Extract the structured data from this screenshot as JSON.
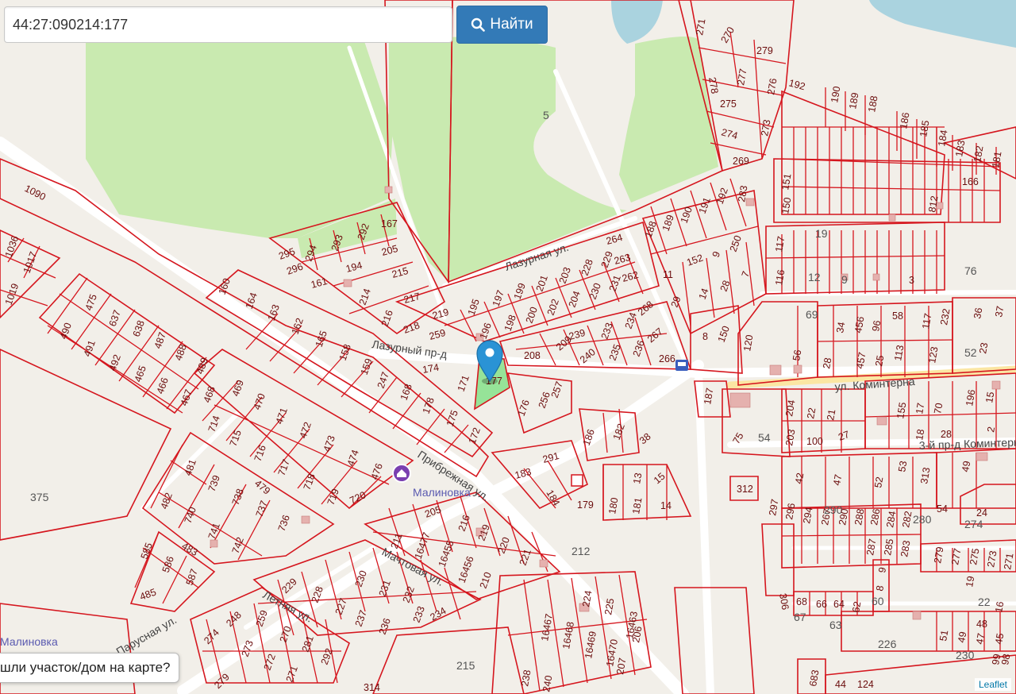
{
  "search": {
    "value": "44:27:090214:177",
    "button_label": "Найти"
  },
  "prompt": "шли участок/дом на карте?",
  "attribution": "Leaflet",
  "map": {
    "colors": {
      "land": "#f2efe9",
      "green": "#c9eab0",
      "water": "#aad3df",
      "road": "#ffffff",
      "main_road": "#fbe6a3",
      "plot_border": "#d5161e",
      "highlight": "#86e08a",
      "marker": "#2a93d5",
      "place_icon": "#7a3fb0"
    },
    "selected_plot": "177",
    "streets": {
      "lazurnaya": "Лазурная ул.",
      "lazurny": "Лазурный пр-д",
      "komintern": "ул. Коминтерна",
      "komintern3": "3-й пр-д Коминтерна",
      "pribrezhnaya": "Прибрежная ул.",
      "machtovaya": "Мачтовая ул.",
      "letnyaya": "Летняя ул.",
      "parusnaya": "Парусная ул."
    },
    "places": {
      "malinovka_poi": "Малиновка",
      "malinovka_area": "Малиновка"
    },
    "areas": {
      "a5": "5",
      "a375": "375",
      "a215": "215",
      "a212": "212",
      "a54": "54",
      "a69": "69",
      "a76": "76",
      "a52": "52",
      "a19": "19",
      "a9": "9",
      "a12": "12",
      "a22": "22",
      "a60": "60",
      "a67": "67",
      "a63": "63",
      "a226": "226",
      "a230": "230",
      "a280": "280",
      "a274": "274",
      "a290": "290"
    },
    "plots": {
      "p177": "177",
      "p1090": "1090",
      "p1036": "1036",
      "p1017": "1017",
      "p1019": "1019",
      "p490": "490",
      "p475": "475",
      "p491": "491",
      "p637": "637",
      "p638": "638",
      "p492": "492",
      "p487": "487",
      "p488": "488",
      "p465": "465",
      "p466": "466",
      "p489": "489",
      "p467": "467",
      "p468": "468",
      "p295": "295",
      "p294": "294",
      "p293": "293",
      "p292": "292",
      "p167": "167",
      "p296": "296",
      "p161": "161",
      "p194": "194",
      "p205": "205",
      "p215": "215",
      "p214": "214",
      "p217": "217",
      "p216": "216",
      "p218": "218",
      "p219": "219",
      "p259": "259",
      "p195": "195",
      "p197": "197",
      "p199": "199",
      "p201": "201",
      "p203": "203",
      "p228": "228",
      "p229": "229",
      "p264": "264",
      "p196": "196",
      "p198": "198",
      "p200": "200",
      "p202": "202",
      "p204": "204",
      "p230": "230",
      "p231": "231",
      "p263": "263",
      "p262": "262",
      "p160": "160",
      "p164": "164",
      "p163": "163",
      "p162": "162",
      "p165": "165",
      "p158": "158",
      "p159": "159",
      "p174": "174",
      "p247": "247",
      "p168": "168",
      "p171": "171",
      "p178": "178",
      "p175": "175",
      "p172": "172",
      "p208": "208",
      "p209": "209",
      "p239": "239",
      "p240": "240",
      "p233": "233",
      "p235": "235",
      "p234": "234",
      "p236": "236",
      "p268": "268",
      "p267": "267",
      "p266": "266",
      "p176": "176",
      "p256": "256",
      "p257": "257",
      "p186": "186",
      "p182": "182",
      "p38": "38",
      "p291": "291",
      "p183": "183",
      "p184": "184",
      "p179": "179",
      "p180": "180",
      "p181": "181",
      "p13": "13",
      "p15": "15",
      "p14": "14",
      "p714": "714",
      "p469": "469",
      "p470": "470",
      "p715": "715",
      "p471": "471",
      "p716": "716",
      "p472": "472",
      "p717": "717",
      "p473": "473",
      "p718": "718",
      "p474": "474",
      "p719": "719",
      "p476": "476",
      "p720": "720",
      "p481": "481",
      "p739": "739",
      "p479": "479",
      "p482": "482",
      "p740": "740",
      "p738": "738",
      "p737": "737",
      "p741": "741",
      "p736": "736",
      "p742": "742",
      "p483": "483",
      "p585": "585",
      "p586": "586",
      "p587": "587",
      "p485": "485",
      "p211": "211",
      "p205b": "205",
      "p16477": "16477",
      "p16455": "16455",
      "p216b": "216",
      "p219b": "219",
      "p220": "220",
      "p221": "221",
      "p16456": "16456",
      "p210": "210",
      "p229b": "229",
      "p228b": "228",
      "p227": "227",
      "p230b": "230",
      "p231b": "231",
      "p232": "232",
      "p233b": "233",
      "p234b": "234",
      "p237": "237",
      "p236b": "236",
      "p248": "248",
      "p274": "274",
      "p259b": "259",
      "p273": "273",
      "p270": "270",
      "p272": "272",
      "p281": "281",
      "p271": "271",
      "p292b": "292",
      "p279": "279",
      "p16467": "16467",
      "p16468": "16468",
      "p224": "224",
      "p225": "225",
      "p16463": "16463",
      "p16469": "16469",
      "p16470": "16470",
      "p206": "206",
      "p207": "207",
      "p238": "238",
      "p240b": "240",
      "p314": "314",
      "p271c": "271",
      "p270c": "270",
      "p279c": "279",
      "p278": "278",
      "p277": "277",
      "p276": "276",
      "p275": "275",
      "p274c": "274",
      "p273c": "273",
      "p269": "269",
      "p283": "283",
      "p192": "192",
      "p191": "191",
      "p190": "190",
      "p189": "189",
      "p188": "188",
      "p192n": "192",
      "p190n": "190",
      "p189n": "189",
      "p188n": "188",
      "p186n": "186",
      "p185": "185",
      "p184n": "184",
      "p183n": "183",
      "p182n": "182",
      "p181n": "181",
      "p166": "166",
      "p151": "151",
      "p150": "150",
      "p812": "812",
      "p117": "117",
      "p116": "116",
      "p3": "3",
      "p11": "11",
      "p152": "152",
      "p9": "9",
      "p250": "250",
      "p29": "29",
      "p14b": "14",
      "p28": "28",
      "p7": "7",
      "p8": "8",
      "p150b": "150",
      "p120": "120",
      "p56": "56",
      "p28b": "28",
      "p34": "34",
      "p456": "456",
      "p96": "96",
      "p58": "58",
      "p117b": "117",
      "p232b": "232",
      "p36": "36",
      "p37": "37",
      "p457": "457",
      "p25": "25",
      "p113": "113",
      "p123": "123",
      "p23": "23",
      "p187": "187",
      "p75": "75",
      "p204b": "204",
      "p22": "22",
      "p21": "21",
      "p155": "155",
      "p17": "17",
      "p70": "70",
      "p196b": "196",
      "p15b": "15",
      "p203b": "203",
      "p100": "100",
      "p27": "27",
      "p18": "18",
      "p28c": "28",
      "p2": "2",
      "p312": "312",
      "p42": "42",
      "p47": "47",
      "p52": "52",
      "p53": "53",
      "p313": "313",
      "p49": "49",
      "p54": "54",
      "p24": "24",
      "p297": "297",
      "p296b": "296",
      "p294b": "294",
      "p267b": "267",
      "p290b": "290",
      "p288": "288",
      "p286": "286",
      "p284": "284",
      "p282": "282",
      "p287": "287",
      "p285": "285",
      "p283b": "283",
      "p279b": "279",
      "p277b": "277",
      "p275b": "275",
      "p273b": "273",
      "p271b": "271",
      "p19": "19",
      "p306": "306",
      "p9b": "9",
      "p8b": "8",
      "p68": "68",
      "p66": "66",
      "p64": "64",
      "p62": "62",
      "p48": "48",
      "p51": "51",
      "p49b": "49",
      "p47b": "47",
      "p45": "45",
      "p683": "683",
      "p44": "44",
      "p124": "124",
      "p16": "16",
      "p99": "99",
      "p98": "98"
    }
  }
}
